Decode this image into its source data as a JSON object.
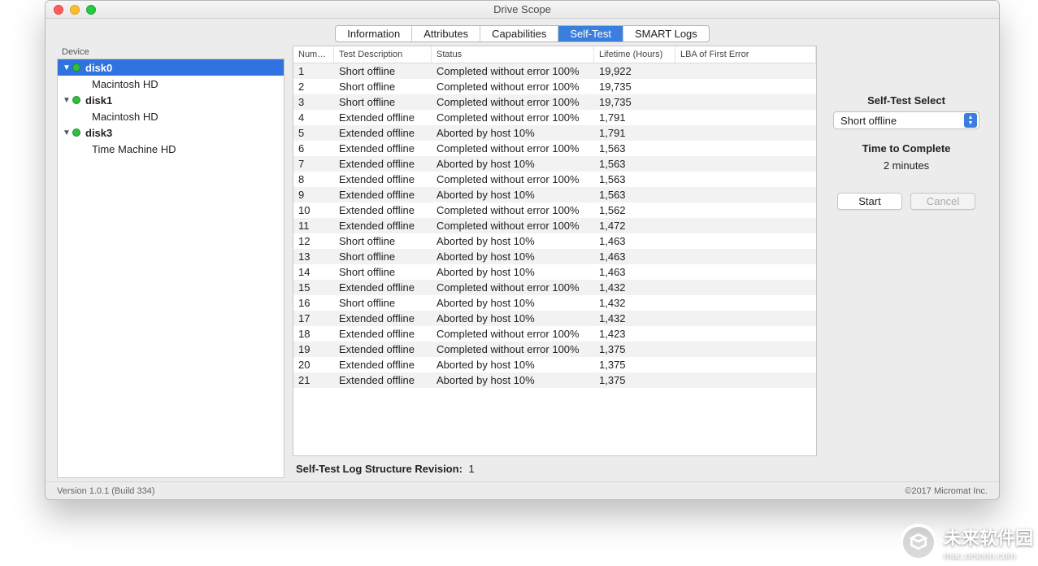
{
  "window": {
    "title": "Drive Scope"
  },
  "tabs": [
    {
      "label": "Information",
      "selected": false
    },
    {
      "label": "Attributes",
      "selected": false
    },
    {
      "label": "Capabilities",
      "selected": false
    },
    {
      "label": "Self-Test",
      "selected": true
    },
    {
      "label": "SMART Logs",
      "selected": false
    }
  ],
  "sidebar": {
    "header": "Device",
    "items": [
      {
        "name": "disk0",
        "selected": true,
        "children": [
          "Macintosh HD"
        ]
      },
      {
        "name": "disk1",
        "selected": false,
        "children": [
          "Macintosh HD"
        ]
      },
      {
        "name": "disk3",
        "selected": false,
        "children": [
          "Time Machine HD"
        ]
      }
    ]
  },
  "table": {
    "columns": [
      "Number",
      "Test Description",
      "Status",
      "Lifetime (Hours)",
      "LBA of First Error"
    ],
    "rows": [
      {
        "n": "1",
        "desc": "Short offline",
        "status": "Completed without error 100%",
        "life": "19,922",
        "lba": ""
      },
      {
        "n": "2",
        "desc": "Short offline",
        "status": "Completed without error 100%",
        "life": "19,735",
        "lba": ""
      },
      {
        "n": "3",
        "desc": "Short offline",
        "status": "Completed without error 100%",
        "life": "19,735",
        "lba": ""
      },
      {
        "n": "4",
        "desc": "Extended offline",
        "status": "Completed without error 100%",
        "life": "1,791",
        "lba": ""
      },
      {
        "n": "5",
        "desc": "Extended offline",
        "status": "Aborted by host 10%",
        "life": "1,791",
        "lba": ""
      },
      {
        "n": "6",
        "desc": "Extended offline",
        "status": "Completed without error 100%",
        "life": "1,563",
        "lba": ""
      },
      {
        "n": "7",
        "desc": "Extended offline",
        "status": "Aborted by host 10%",
        "life": "1,563",
        "lba": ""
      },
      {
        "n": "8",
        "desc": "Extended offline",
        "status": "Completed without error 100%",
        "life": "1,563",
        "lba": ""
      },
      {
        "n": "9",
        "desc": "Extended offline",
        "status": "Aborted by host 10%",
        "life": "1,563",
        "lba": ""
      },
      {
        "n": "10",
        "desc": "Extended offline",
        "status": "Completed without error 100%",
        "life": "1,562",
        "lba": ""
      },
      {
        "n": "11",
        "desc": "Extended offline",
        "status": "Completed without error 100%",
        "life": "1,472",
        "lba": ""
      },
      {
        "n": "12",
        "desc": "Short offline",
        "status": "Aborted by host 10%",
        "life": "1,463",
        "lba": ""
      },
      {
        "n": "13",
        "desc": "Short offline",
        "status": "Aborted by host 10%",
        "life": "1,463",
        "lba": ""
      },
      {
        "n": "14",
        "desc": "Short offline",
        "status": "Aborted by host 10%",
        "life": "1,463",
        "lba": ""
      },
      {
        "n": "15",
        "desc": "Extended offline",
        "status": "Completed without error 100%",
        "life": "1,432",
        "lba": ""
      },
      {
        "n": "16",
        "desc": "Short offline",
        "status": "Aborted by host 10%",
        "life": "1,432",
        "lba": ""
      },
      {
        "n": "17",
        "desc": "Extended offline",
        "status": "Aborted by host 10%",
        "life": "1,432",
        "lba": ""
      },
      {
        "n": "18",
        "desc": "Extended offline",
        "status": "Completed without error 100%",
        "life": "1,423",
        "lba": ""
      },
      {
        "n": "19",
        "desc": "Extended offline",
        "status": "Completed without error 100%",
        "life": "1,375",
        "lba": ""
      },
      {
        "n": "20",
        "desc": "Extended offline",
        "status": "Aborted by host 10%",
        "life": "1,375",
        "lba": ""
      },
      {
        "n": "21",
        "desc": "Extended offline",
        "status": "Aborted by host 10%",
        "life": "1,375",
        "lba": ""
      }
    ]
  },
  "revision": {
    "label": "Self-Test Log Structure Revision:",
    "value": "1"
  },
  "selftest": {
    "select_label": "Self-Test Select",
    "select_value": "Short offline",
    "time_label": "Time to Complete",
    "time_value": "2 minutes",
    "start_label": "Start",
    "cancel_label": "Cancel"
  },
  "footer": {
    "version": "Version 1.0.1 (Build 334)",
    "copyright": "©2017 Micromat Inc."
  },
  "watermark": {
    "main": "未来软件园",
    "sub": "mac.orsoon.com"
  }
}
